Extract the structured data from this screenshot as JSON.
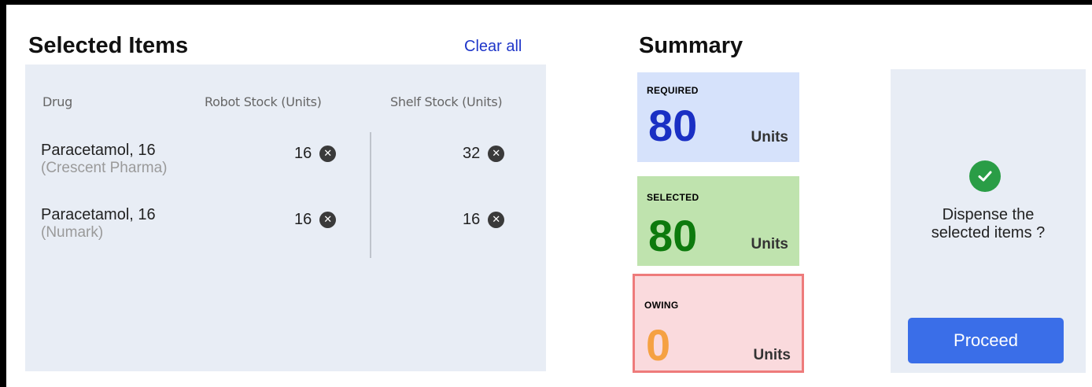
{
  "selected_items": {
    "title": "Selected Items",
    "clear_all": "Clear all",
    "columns": {
      "drug": "Drug",
      "robot": "Robot Stock (Units)",
      "shelf": "Shelf Stock (Units)"
    },
    "rows": [
      {
        "name": "Paracetamol, 16",
        "manufacturer": "(Crescent Pharma)",
        "robot": "16",
        "shelf": "32"
      },
      {
        "name": "Paracetamol, 16",
        "manufacturer": "(Numark)",
        "robot": "16",
        "shelf": "16"
      }
    ]
  },
  "summary": {
    "title": "Summary",
    "required": {
      "label": "REQUIRED",
      "value": "80",
      "units": "Units",
      "bg": "#d6e2fb",
      "value_color": "#1a2fc4"
    },
    "selected": {
      "label": "SELECTED",
      "value": "80",
      "units": "Units",
      "bg": "#bfe3ae",
      "value_color": "#0d7a0d"
    },
    "owing": {
      "label": "OWING",
      "value": "0",
      "units": "Units",
      "bg": "#fadadd",
      "value_color": "#f5a142",
      "border": "#ee7b7b"
    }
  },
  "action": {
    "prompt_line1": "Dispense the",
    "prompt_line2": "selected items ?",
    "proceed_label": "Proceed",
    "icon": "check-circle-icon"
  }
}
